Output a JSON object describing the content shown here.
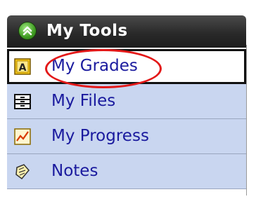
{
  "panel": {
    "title": "My Tools",
    "items": [
      {
        "label": "My Grades",
        "icon": "grades-icon",
        "active": true
      },
      {
        "label": "My Files",
        "icon": "files-icon",
        "active": false
      },
      {
        "label": "My Progress",
        "icon": "progress-icon",
        "active": false
      },
      {
        "label": "Notes",
        "icon": "notes-icon",
        "active": false
      }
    ]
  },
  "colors": {
    "header_bg": "#2a2a2a",
    "item_bg": "#c9d6f0",
    "link_text": "#1a1a9e",
    "annotation": "#e31818"
  }
}
